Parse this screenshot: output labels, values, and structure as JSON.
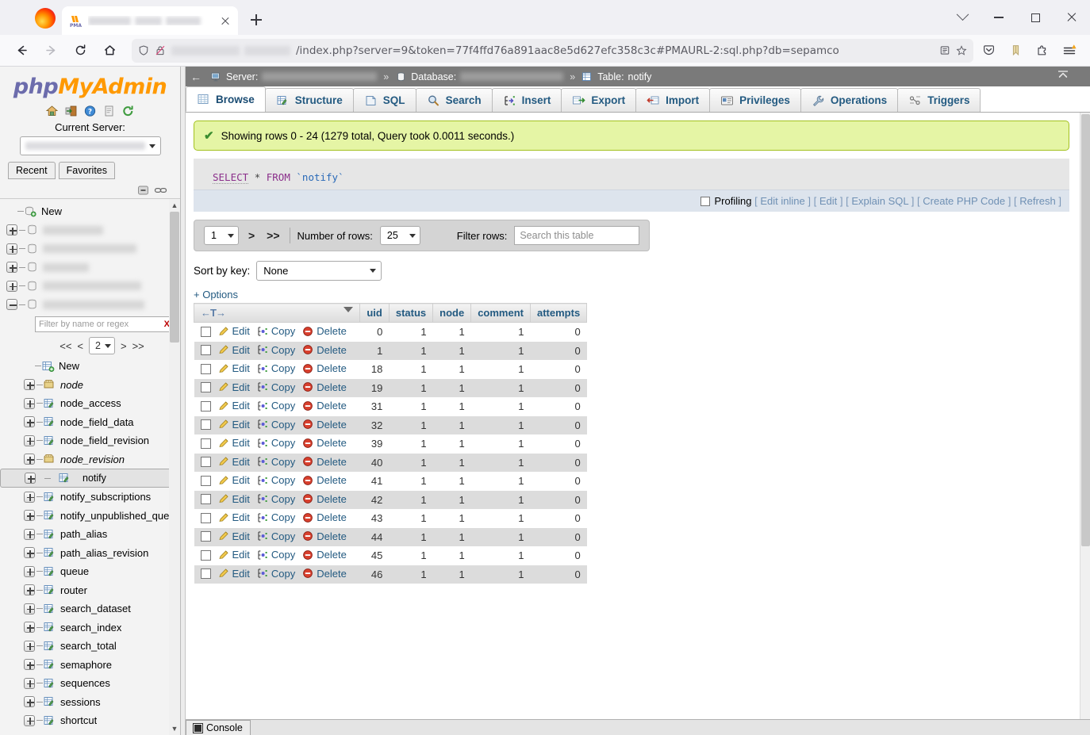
{
  "browser": {
    "tab": {
      "favicon": "pma-favicon",
      "title_redacted": true,
      "close_label": "×"
    },
    "newtab_label": "+",
    "window": {
      "tablist_icon": "chevron-down-icon",
      "minimize": "−",
      "maximize": "□",
      "close": "×"
    },
    "nav": {
      "back": "←",
      "forward": "→",
      "reload": "⟳",
      "home": "⌂"
    },
    "url": {
      "shield_icon": "shield-icon",
      "lock_icon": "lock-broken-icon",
      "domain_redacted": true,
      "path": "/index.php?server=9&token=77f4ffd76a891aac8e5d627efc358c3c#PMAURL-2:sql.php?db=sepamco",
      "reader_icon": "reader-view-icon",
      "bookmark_icon": "star-icon"
    },
    "toolbar_right": [
      "pocket-icon",
      "bookmarks-icon",
      "extensions-icon",
      "app-menu-icon"
    ]
  },
  "nav_panel": {
    "logo": {
      "php": "php",
      "my": "My",
      "admin": "Admin"
    },
    "icons": [
      "home-icon",
      "logout-icon",
      "docs-icon",
      "pma-docs-icon",
      "reload-icon"
    ],
    "current_server_label": "Current Server:",
    "server_value_redacted": true,
    "recent_label": "Recent",
    "favorites_label": "Favorites",
    "tools": [
      "collapse-all-icon",
      "link-with-main-panel-icon"
    ],
    "db_new_label": "New",
    "db_items_redacted": 5,
    "filter": {
      "placeholder": "Filter by name or regex",
      "clear": "X"
    },
    "pagination": {
      "first": "<<",
      "prev": "<",
      "page": "2",
      "next": ">",
      "last": ">>"
    },
    "table_new_label": "New",
    "tables": [
      {
        "name": "node",
        "type": "view",
        "selected": false
      },
      {
        "name": "node_access",
        "type": "table",
        "selected": false
      },
      {
        "name": "node_field_data",
        "type": "table",
        "selected": false
      },
      {
        "name": "node_field_revision",
        "type": "table",
        "selected": false
      },
      {
        "name": "node_revision",
        "type": "view",
        "selected": false
      },
      {
        "name": "notify",
        "type": "table",
        "selected": true
      },
      {
        "name": "notify_subscriptions",
        "type": "table",
        "selected": false
      },
      {
        "name": "notify_unpublished_queue",
        "type": "table",
        "selected": false
      },
      {
        "name": "path_alias",
        "type": "table",
        "selected": false
      },
      {
        "name": "path_alias_revision",
        "type": "table",
        "selected": false
      },
      {
        "name": "queue",
        "type": "table",
        "selected": false
      },
      {
        "name": "router",
        "type": "table",
        "selected": false
      },
      {
        "name": "search_dataset",
        "type": "table",
        "selected": false
      },
      {
        "name": "search_index",
        "type": "table",
        "selected": false
      },
      {
        "name": "search_total",
        "type": "table",
        "selected": false
      },
      {
        "name": "semaphore",
        "type": "table",
        "selected": false
      },
      {
        "name": "sequences",
        "type": "table",
        "selected": false
      },
      {
        "name": "sessions",
        "type": "table",
        "selected": false
      },
      {
        "name": "shortcut",
        "type": "table",
        "selected": false
      }
    ]
  },
  "breadcrumb": {
    "back": "←",
    "server_label": "Server:",
    "server_value_redacted": true,
    "database_label": "Database:",
    "database_value_redacted": true,
    "table_label": "Table:",
    "table_value": "notify",
    "separator": "»",
    "collapse_icon": "collapse-icon"
  },
  "tabs": [
    {
      "label": "Browse",
      "icon": "browse-icon",
      "active": true
    },
    {
      "label": "Structure",
      "icon": "structure-icon",
      "active": false
    },
    {
      "label": "SQL",
      "icon": "sql-icon",
      "active": false
    },
    {
      "label": "Search",
      "icon": "search-icon",
      "active": false
    },
    {
      "label": "Insert",
      "icon": "insert-icon",
      "active": false
    },
    {
      "label": "Export",
      "icon": "export-icon",
      "active": false
    },
    {
      "label": "Import",
      "icon": "import-icon",
      "active": false
    },
    {
      "label": "Privileges",
      "icon": "privileges-icon",
      "active": false
    },
    {
      "label": "Operations",
      "icon": "operations-icon",
      "active": false
    },
    {
      "label": "Triggers",
      "icon": "triggers-icon",
      "active": false
    }
  ],
  "result_message": "Showing rows 0 - 24 (1279 total, Query took 0.0011 seconds.)",
  "sql": {
    "select": "SELECT",
    "star": "*",
    "from": "FROM",
    "table": "`notify`"
  },
  "profiling": {
    "label": "Profiling",
    "checked": false,
    "links": [
      "Edit inline",
      "Edit",
      "Explain SQL",
      "Create PHP Code",
      "Refresh"
    ],
    "open_bracket": "[",
    "close_bracket": "]"
  },
  "controls": {
    "page_value": "1",
    "next": ">",
    "last": ">>",
    "rows_label": "Number of rows:",
    "rows_value": "25",
    "filter_label": "Filter rows:",
    "filter_placeholder": "Search this table"
  },
  "sort": {
    "label": "Sort by key:",
    "value": "None"
  },
  "options_link": "+ Options",
  "table": {
    "sort_indicator": "←T→",
    "action_labels": {
      "edit": "Edit",
      "copy": "Copy",
      "delete": "Delete"
    },
    "action_icons": {
      "edit": "pencil-icon",
      "copy": "copy-icon",
      "delete": "delete-icon"
    },
    "columns": [
      "uid",
      "status",
      "node",
      "comment",
      "attempts"
    ],
    "rows": [
      {
        "uid": "0",
        "status": "1",
        "node": "1",
        "comment": "1",
        "attempts": "0"
      },
      {
        "uid": "1",
        "status": "1",
        "node": "1",
        "comment": "1",
        "attempts": "0"
      },
      {
        "uid": "18",
        "status": "1",
        "node": "1",
        "comment": "1",
        "attempts": "0"
      },
      {
        "uid": "19",
        "status": "1",
        "node": "1",
        "comment": "1",
        "attempts": "0"
      },
      {
        "uid": "31",
        "status": "1",
        "node": "1",
        "comment": "1",
        "attempts": "0"
      },
      {
        "uid": "32",
        "status": "1",
        "node": "1",
        "comment": "1",
        "attempts": "0"
      },
      {
        "uid": "39",
        "status": "1",
        "node": "1",
        "comment": "1",
        "attempts": "0"
      },
      {
        "uid": "40",
        "status": "1",
        "node": "1",
        "comment": "1",
        "attempts": "0"
      },
      {
        "uid": "41",
        "status": "1",
        "node": "1",
        "comment": "1",
        "attempts": "0"
      },
      {
        "uid": "42",
        "status": "1",
        "node": "1",
        "comment": "1",
        "attempts": "0"
      },
      {
        "uid": "43",
        "status": "1",
        "node": "1",
        "comment": "1",
        "attempts": "0"
      },
      {
        "uid": "44",
        "status": "1",
        "node": "1",
        "comment": "1",
        "attempts": "0"
      },
      {
        "uid": "45",
        "status": "1",
        "node": "1",
        "comment": "1",
        "attempts": "0"
      },
      {
        "uid": "46",
        "status": "1",
        "node": "1",
        "comment": "1",
        "attempts": "0"
      }
    ]
  },
  "console": {
    "label": "Console",
    "icon": "console-icon"
  },
  "colors": {
    "pma_orange": "#f90",
    "pma_purple": "#6c6cac",
    "link_blue": "#235a81",
    "alert_bg": "#e5f5a5",
    "alert_border": "#a3c11f",
    "breadcrumb_bg": "#7a7a7a"
  }
}
